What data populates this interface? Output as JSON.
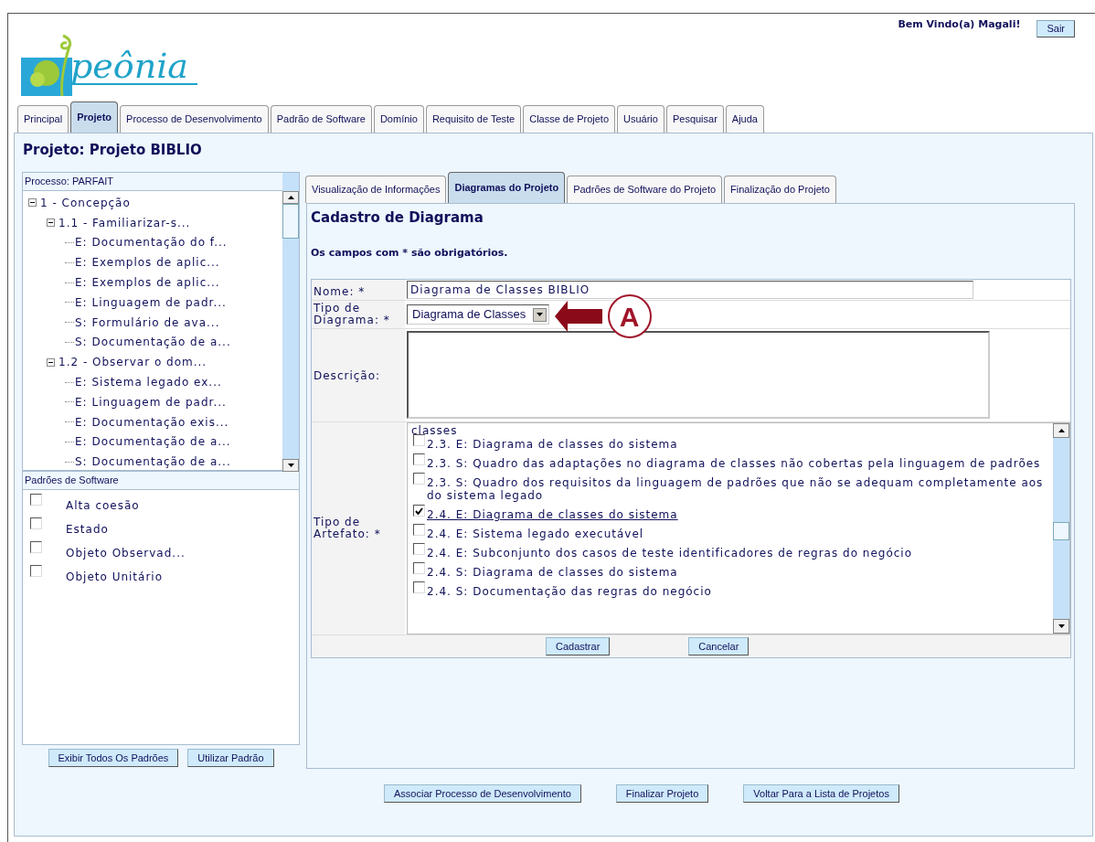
{
  "logo": {
    "text": "peônia"
  },
  "user": {
    "greeting": "Bem Vindo(a) Magali!",
    "logout": "Sair"
  },
  "main_tabs": [
    {
      "label": "Principal",
      "selected": false
    },
    {
      "label": "Projeto",
      "selected": true
    },
    {
      "label": "Processo de Desenvolvimento",
      "selected": false
    },
    {
      "label": "Padrão de Software",
      "selected": false
    },
    {
      "label": "Domínio",
      "selected": false
    },
    {
      "label": "Requisito de Teste",
      "selected": false
    },
    {
      "label": "Classe de Projeto",
      "selected": false
    },
    {
      "label": "Usuário",
      "selected": false
    },
    {
      "label": "Pesquisar",
      "selected": false
    },
    {
      "label": "Ajuda",
      "selected": false
    }
  ],
  "page_title": "Projeto: Projeto BIBLIO",
  "process_tree": {
    "header": "Processo: PARFAIT",
    "items": [
      {
        "label": "1 - Concepção",
        "expanded": true,
        "children": [
          {
            "label": "1.1 - Familiarizar-s...",
            "expanded": true,
            "children": [
              {
                "label": "E: Documentação do f..."
              },
              {
                "label": "E: Exemplos de aplic..."
              },
              {
                "label": "E: Exemplos de aplic..."
              },
              {
                "label": "E: Linguagem de padr..."
              },
              {
                "label": "S: Formulário de ava..."
              },
              {
                "label": "S: Documentação de a..."
              }
            ]
          },
          {
            "label": "1.2 - Observar o dom...",
            "expanded": true,
            "children": [
              {
                "label": "E: Sistema legado ex..."
              },
              {
                "label": "E: Linguagem de padr..."
              },
              {
                "label": "E: Documentação exis..."
              },
              {
                "label": "E: Documentação de a..."
              },
              {
                "label": "S: Documentação de a..."
              }
            ]
          }
        ]
      }
    ]
  },
  "patterns": {
    "header": "Padrões de Software",
    "items": [
      {
        "label": "Alta coesão",
        "checked": false
      },
      {
        "label": "Estado",
        "checked": false
      },
      {
        "label": "Objeto Observad...",
        "checked": false
      },
      {
        "label": "Objeto Unitário",
        "checked": false
      }
    ],
    "buttons": [
      "Exibir Todos Os Padrões",
      "Utilizar Padrão"
    ]
  },
  "project_tabs": [
    {
      "label": "Visualização de Informações",
      "selected": false
    },
    {
      "label": "Diagramas do Projeto",
      "selected": true
    },
    {
      "label": "Padrões de Software do Projeto",
      "selected": false
    },
    {
      "label": "Finalização do Projeto",
      "selected": false
    }
  ],
  "form": {
    "title": "Cadastro de Diagrama",
    "note": "Os campos com * são obrigatórios.",
    "name_label": "Nome: *",
    "name_value": "Diagrama de Classes BIBLIO",
    "type_label": "Tipo de Diagrama: *",
    "type_value": "Diagrama de Classes",
    "description_label": "Descrição:",
    "artifact_label": "Tipo de Artefato: *",
    "artifacts": [
      {
        "kind": "text",
        "label": "classes"
      },
      {
        "kind": "check",
        "label": "2.3. E: Diagrama de classes do sistema",
        "checked": false,
        "selected": false
      },
      {
        "kind": "check",
        "label": "2.3. S: Quadro das adaptações no diagrama de classes não cobertas pela linguagem de padrões",
        "checked": false,
        "selected": false
      },
      {
        "kind": "check",
        "label": "2.3. S: Quadro dos requisitos da linguagem de padrões que não se adequam completamente aos do sistema legado",
        "checked": false,
        "selected": false
      },
      {
        "kind": "check",
        "label": "2.4. E: Diagrama de classes do sistema",
        "checked": true,
        "selected": true
      },
      {
        "kind": "check",
        "label": "2.4. E: Sistema legado executável",
        "checked": false,
        "selected": false
      },
      {
        "kind": "check",
        "label": "2.4. E: Subconjunto dos casos de teste identificadores de regras do negócio",
        "checked": false,
        "selected": false
      },
      {
        "kind": "check",
        "label": "2.4. S: Diagrama de classes do sistema",
        "checked": false,
        "selected": false
      },
      {
        "kind": "check",
        "label": "2.4. S: Documentação das regras do negócio",
        "checked": false,
        "selected": false
      }
    ],
    "buttons": [
      "Cadastrar",
      "Cancelar"
    ]
  },
  "annotation": {
    "label": "A"
  },
  "footer_buttons": [
    "Associar Processo de Desenvolvimento",
    "Finalizar Projeto",
    "Voltar Para a Lista de Projetos"
  ]
}
